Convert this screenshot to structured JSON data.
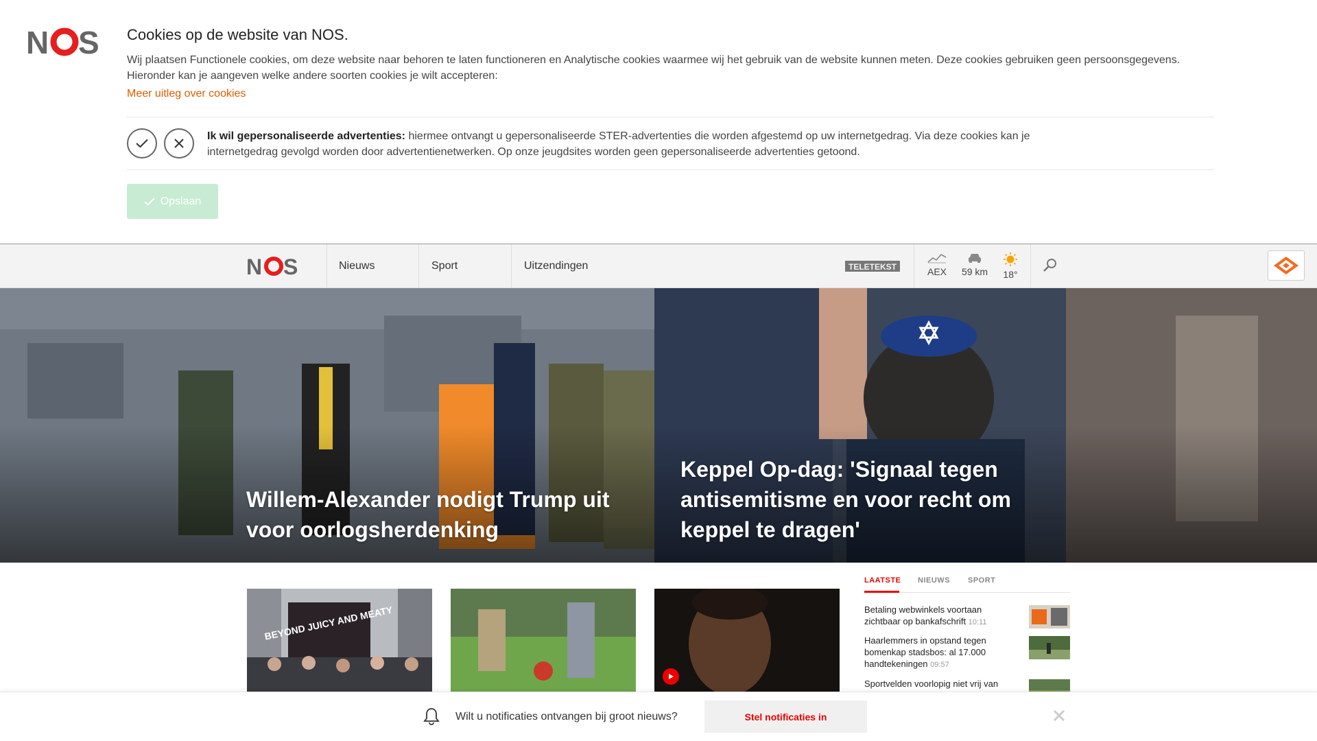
{
  "brand": {
    "logo_text": "NOS",
    "accent": "#e61e1e",
    "link_color": "#e25c00"
  },
  "cookie": {
    "title": "Cookies op de website van NOS.",
    "description": "Wij plaatsen Functionele cookies, om deze website naar behoren te laten functioneren en Analytische cookies waarmee wij het gebruik van de website kunnen meten. Deze cookies gebruiken geen persoonsgegevens. Hieronder kan je aangeven welke andere soorten cookies je wilt accepteren:",
    "more_link": "Meer uitleg over cookies",
    "option_label": "Ik wil gepersonaliseerde advertenties:",
    "option_text": " hiermee ontvangt u gepersonaliseerde STER-advertenties die worden afgestemd op uw internetgedrag. Via deze cookies kan je internetgedrag gevolgd worden door advertentienetwerken. Op onze jeugdsites worden geen gepersonaliseerde advertenties getoond.",
    "save_label": "Opslaan"
  },
  "nav": {
    "items": [
      {
        "label": "Nieuws"
      },
      {
        "label": "Sport"
      },
      {
        "label": "Uitzendingen"
      }
    ],
    "teletekst": "TELETEKST",
    "widgets": [
      {
        "label": "AEX",
        "icon": "stock-chart-icon"
      },
      {
        "label": "59 km",
        "icon": "car-icon"
      },
      {
        "label": "18°",
        "icon": "sun-icon"
      }
    ],
    "npo_label": "NPO start"
  },
  "hero": [
    {
      "title": "Willem-Alexander nodigt Trump uit voor oorlogsherdenking"
    },
    {
      "title": "Keppel Op-dag: 'Signaal tegen antisemitisme en voor recht om keppel te dragen'"
    }
  ],
  "thumbs": [
    {
      "caption": "BEYOND JUICY AND MEATY"
    },
    {
      "caption": ""
    },
    {
      "caption": ""
    }
  ],
  "latest": {
    "tabs": [
      "LAATSTE",
      "NIEUWS",
      "SPORT"
    ],
    "items": [
      {
        "text": "Betaling webwinkels voortaan zichtbaar op bankafschrift",
        "time": "10:11"
      },
      {
        "text": "Haarlemmers in opstand tegen bomenkap stadsbos: al 17.000 handtekeningen",
        "time": "09:57"
      },
      {
        "text": "Sportvelden voorlopig niet vrij van",
        "time": ""
      }
    ]
  },
  "notification": {
    "question": "Wilt u notificaties ontvangen bij groot nieuws?",
    "button": "Stel notificaties in"
  }
}
